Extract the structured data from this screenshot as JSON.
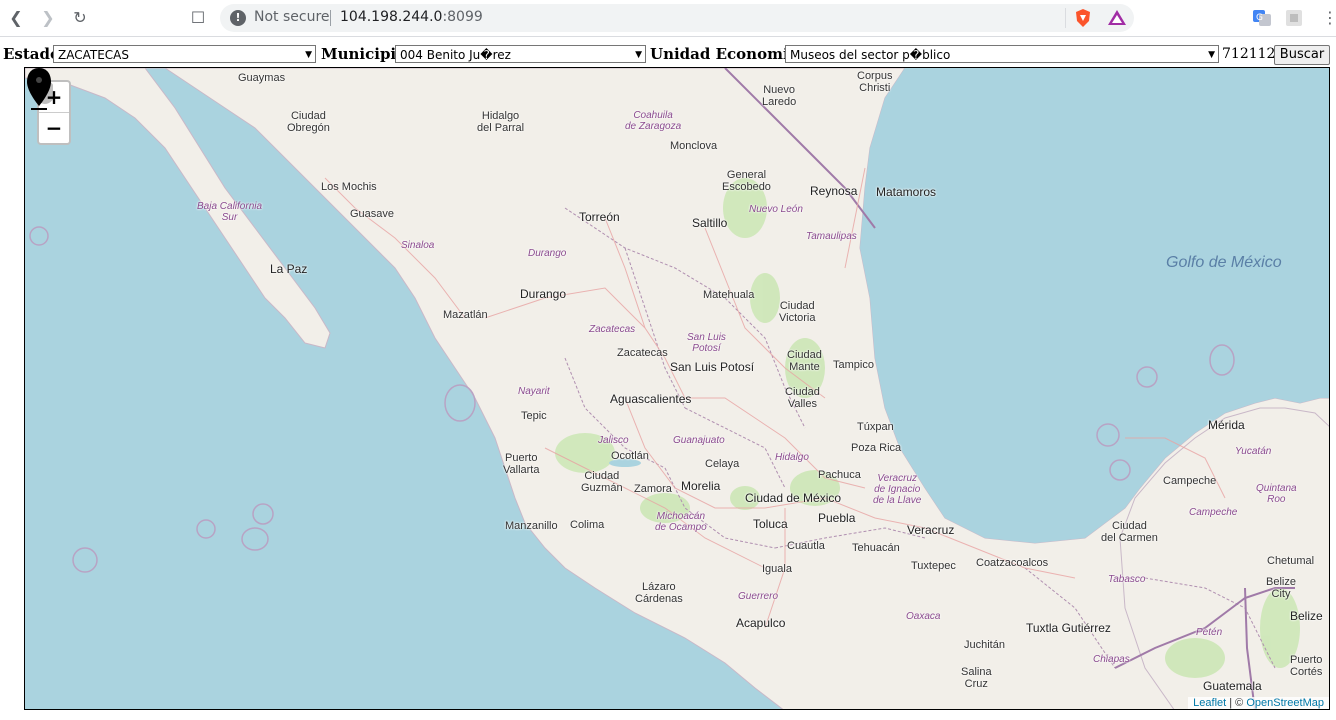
{
  "browser": {
    "status": "Not secure",
    "url_host": "104.198.244.0",
    "url_port": ":8099"
  },
  "form": {
    "estado_label": "Estado",
    "estado_value": "ZACATECAS",
    "municipio_label": "Municipio",
    "municipio_value": "004 Benito Ju�rez",
    "unidad_label": "Unidad Economica",
    "unidad_value": "Museos del sector p�blico",
    "count": "712112",
    "buscar_label": "Buscar"
  },
  "map": {
    "zoom_in": "+",
    "zoom_out": "−",
    "attribution_leaflet": "Leaflet",
    "attribution_sep": " | © ",
    "attribution_osm": "OpenStreetMap",
    "labels": {
      "guaymas": "Guaymas",
      "obregon": "Ciudad\nObregón",
      "hidalgo_parral": "Hidalgo\ndel Parral",
      "coahuila": "Coahuila\nde Zaragoza",
      "monclova": "Monclova",
      "nuevo_laredo": "Nuevo\nLaredo",
      "corpus": "Corpus\nChristi",
      "los_mochis": "Los Mochis",
      "guasave": "Guasave",
      "bcs": "Baja California\nSur",
      "torreon": "Torreón",
      "saltillo": "Saltillo",
      "escobedo": "General\nEscobedo",
      "nuevo_leon": "Nuevo León",
      "reynosa": "Reynosa",
      "matamoros": "Matamoros",
      "tamaulipas": "Tamaulipas",
      "sinaloa": "Sinaloa",
      "durango_state": "Durango",
      "la_paz": "La Paz",
      "golfo": "Golfo de México",
      "durango": "Durango",
      "matehuala": "Matehuala",
      "victoria": "Ciudad\nVictoria",
      "mazatlan": "Mazatlán",
      "zacatecas_state": "Zacatecas",
      "slp_state": "San Luis\nPotosí",
      "zacatecas": "Zacatecas",
      "slp": "San Luis Potosí",
      "mante": "Ciudad\nMante",
      "tampico": "Tampico",
      "nayarit": "Nayarit",
      "aguascalientes": "Aguascalientes",
      "valles": "Ciudad\nValles",
      "tepic": "Tepic",
      "merida": "Mérida",
      "tuxpan": "Túxpan",
      "jalisco": "Jalisco",
      "guanajuato": "Guanajuato",
      "poza_rica": "Poza Rica",
      "yucatan": "Yucatán",
      "vallarta": "Puerto\nVallarta",
      "ocotlan": "Ocotlán",
      "hidalgo": "Hidalgo",
      "celaya": "Celaya",
      "pachuca": "Pachuca",
      "veracruz_state": "Veracruz\nde Ignacio\nde la Llave",
      "campeche": "Campeche",
      "quintana": "Quintana\nRoo",
      "guzman": "Ciudad\nGuzmán",
      "zamora": "Zamora",
      "morelia": "Morelia",
      "cdmx": "Ciudad de México",
      "manzanillo": "Manzanillo",
      "colima": "Colima",
      "michoacan": "Michoacán\nde Ocampo",
      "toluca": "Toluca",
      "puebla": "Puebla",
      "veracruz": "Veracruz",
      "campeche_state": "Campeche",
      "del_carmen": "Ciudad\ndel Carmen",
      "cuautla": "Cuautla",
      "tehuacan": "Tehuacán",
      "chetumal": "Chetumal",
      "iguala": "Iguala",
      "tuxtepec": "Tuxtepec",
      "coatzacoalcos": "Coatzacoalcos",
      "tabasco": "Tabasco",
      "belize_city": "Belize\nCity",
      "lazaro": "Lázaro\nCárdenas",
      "guerrero": "Guerrero",
      "belize": "Belize",
      "acapulco": "Acapulco",
      "oaxaca": "Oaxaca",
      "tuxtla": "Tuxtla Gutiérrez",
      "peten": "Petén",
      "juchitan": "Juchitán",
      "chiapas": "Chiapas",
      "puerto_cortes": "Puerto\nCortés",
      "salina_cruz": "Salina\nCruz",
      "guatemala": "Guatemala"
    }
  }
}
